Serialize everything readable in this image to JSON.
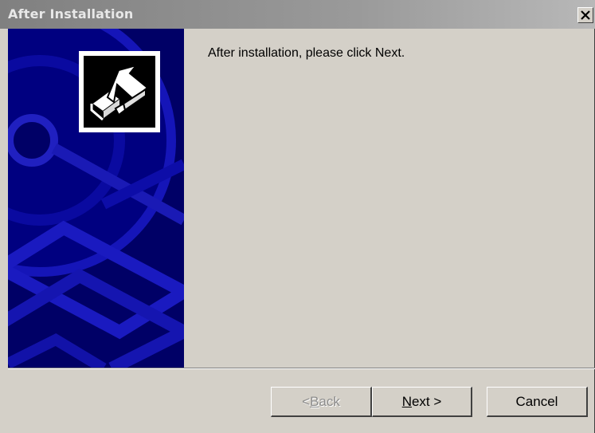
{
  "window": {
    "title": "After Installation",
    "close_icon": "close-icon"
  },
  "banner": {
    "logo_icon": "install-arrow-icon",
    "background_icon": "cd-disc-graphic"
  },
  "content": {
    "message": "After installation, please click Next."
  },
  "buttons": {
    "back": {
      "mnemonic": "B",
      "rest": "ack",
      "prefix": "< ",
      "enabled": false
    },
    "next": {
      "mnemonic": "N",
      "rest": "ext >",
      "enabled": true
    },
    "cancel": {
      "label": "Cancel",
      "enabled": true
    }
  },
  "colors": {
    "banner_background": "#000066",
    "dialog_face": "#d4d0c8",
    "titlebar_inactive": "#808080"
  }
}
